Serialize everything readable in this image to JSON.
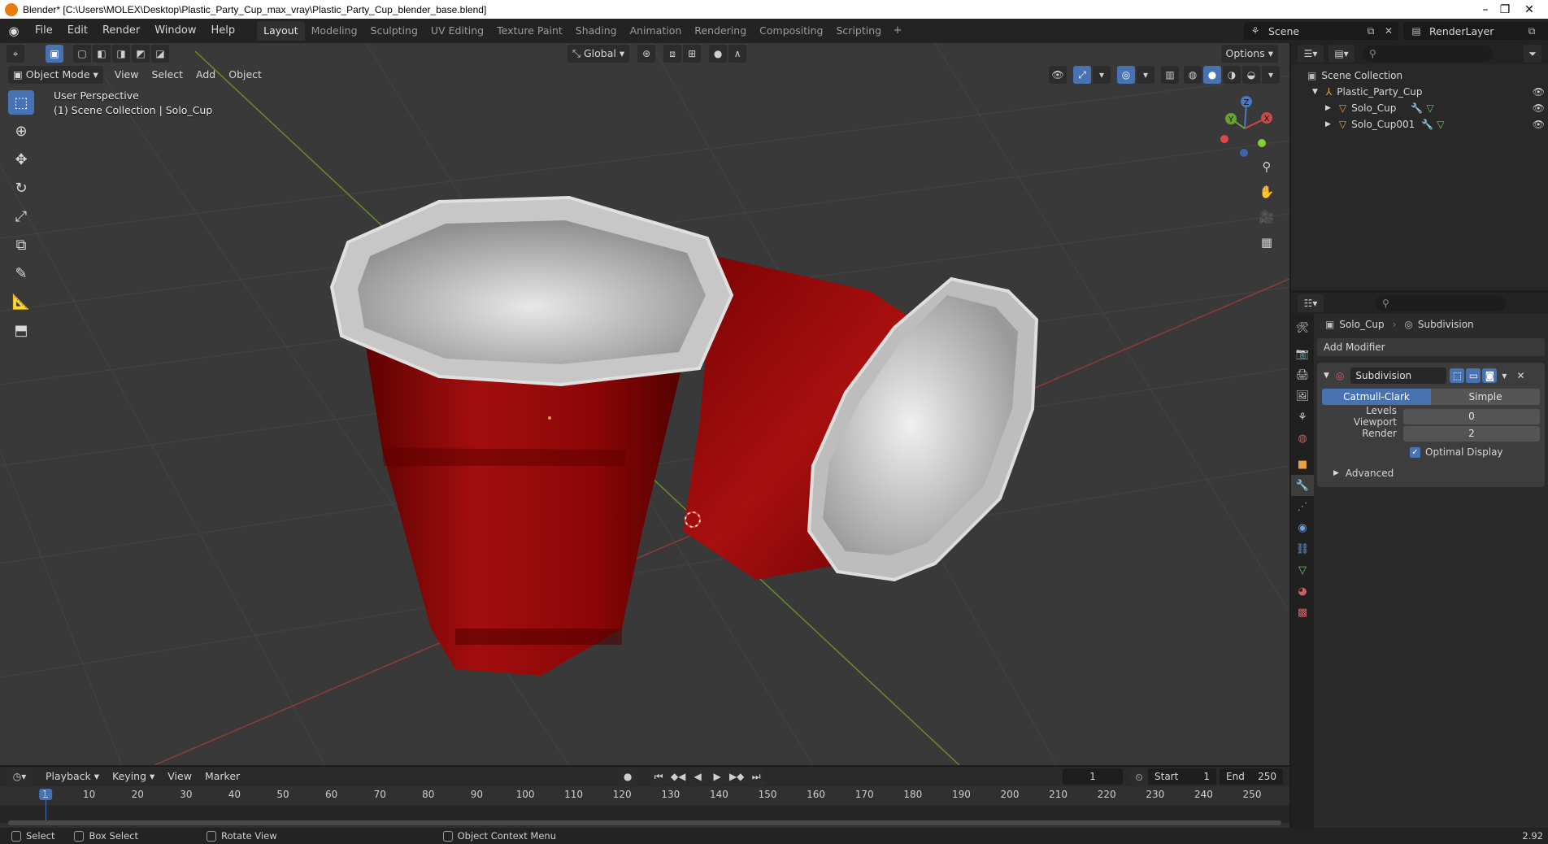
{
  "window": {
    "title": "Blender* [C:\\Users\\MOLEX\\Desktop\\Plastic_Party_Cup_max_vray\\Plastic_Party_Cup_blender_base.blend]",
    "minimize": "–",
    "maximize": "❐",
    "close": "✕"
  },
  "menu": {
    "items": [
      "File",
      "Edit",
      "Render",
      "Window",
      "Help"
    ]
  },
  "workspaces": {
    "tabs": [
      "Layout",
      "Modeling",
      "Sculpting",
      "UV Editing",
      "Texture Paint",
      "Shading",
      "Animation",
      "Rendering",
      "Compositing",
      "Scripting"
    ],
    "active": "Layout",
    "add": "+"
  },
  "scene": {
    "name": "Scene"
  },
  "render_layer": {
    "name": "RenderLayer"
  },
  "viewport": {
    "mode": "Object Mode",
    "menus": [
      "View",
      "Select",
      "Add",
      "Object"
    ],
    "orientation": "Global",
    "options": "Options",
    "info_line1": "User Perspective",
    "info_line2": "(1) Scene Collection | Solo_Cup",
    "gizmo_axes": {
      "x": "X",
      "y": "Y",
      "z": "Z"
    }
  },
  "outliner": {
    "search_placeholder": "",
    "root": "Scene Collection",
    "collection": "Plastic_Party_Cup",
    "objects": [
      "Solo_Cup",
      "Solo_Cup001"
    ]
  },
  "properties": {
    "object": "Solo_Cup",
    "modifier_crumb": "Subdivision",
    "add_modifier": "Add Modifier",
    "modifier": {
      "name": "Subdivision",
      "type_options": [
        "Catmull-Clark",
        "Simple"
      ],
      "type_selected": "Catmull-Clark",
      "levels_viewport_label": "Levels Viewport",
      "levels_viewport": "0",
      "render_label": "Render",
      "render": "2",
      "optimal_display_label": "Optimal Display",
      "optimal_display": true,
      "advanced": "Advanced"
    }
  },
  "timeline": {
    "menus": [
      "Playback",
      "Keying",
      "View",
      "Marker"
    ],
    "current_frame": "1",
    "start_label": "Start",
    "start": "1",
    "end_label": "End",
    "end": "250",
    "ticks": [
      "1",
      "10",
      "20",
      "30",
      "40",
      "50",
      "60",
      "70",
      "80",
      "90",
      "100",
      "110",
      "120",
      "130",
      "140",
      "150",
      "160",
      "170",
      "180",
      "190",
      "200",
      "210",
      "220",
      "230",
      "240",
      "250"
    ]
  },
  "statusbar": {
    "select": "Select",
    "box_select": "Box Select",
    "rotate_view": "Rotate View",
    "context_menu": "Object Context Menu",
    "version": "2.92"
  },
  "colors": {
    "accent": "#4772b3",
    "cup_red": "#9b0a0a",
    "cup_rim": "#c8c8c8",
    "viewport_bg": "#393939"
  }
}
